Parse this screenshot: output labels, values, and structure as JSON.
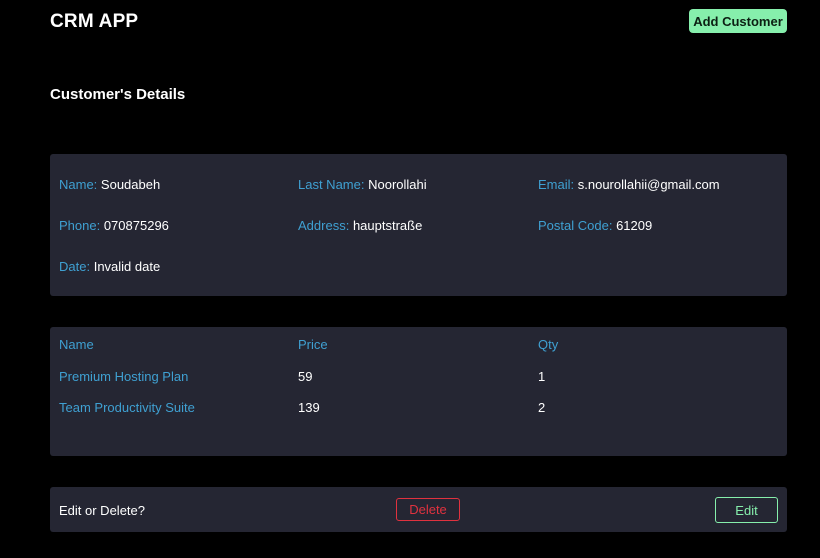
{
  "header": {
    "app_title": "CRM APP",
    "add_customer_label": "Add Customer"
  },
  "section": {
    "title": "Customer's Details"
  },
  "customer": {
    "name_label": "Name:",
    "name": "Soudabeh",
    "last_name_label": "Last Name:",
    "last_name": "Noorollahi",
    "email_label": "Email:",
    "email": "s.nourollahii@gmail.com",
    "phone_label": "Phone:",
    "phone": "070875296",
    "address_label": "Address:",
    "address": "hauptstraße",
    "postal_code_label": "Postal Code:",
    "postal_code": "61209",
    "date_label": "Date:",
    "date": "Invalid date"
  },
  "products": {
    "headers": [
      "Name",
      "Price",
      "Qty"
    ],
    "rows": [
      {
        "name": "Premium Hosting Plan",
        "price": "59",
        "qty": "1"
      },
      {
        "name": "Team Productivity Suite",
        "price": "139",
        "qty": "2"
      }
    ]
  },
  "actions": {
    "prompt": "Edit or Delete?",
    "delete_label": "Delete",
    "edit_label": "Edit"
  },
  "colors": {
    "background": "#000000",
    "card": "#252633",
    "label_blue": "#3fa0d2",
    "accent_green": "#86efac",
    "danger_red": "#e0323f"
  }
}
